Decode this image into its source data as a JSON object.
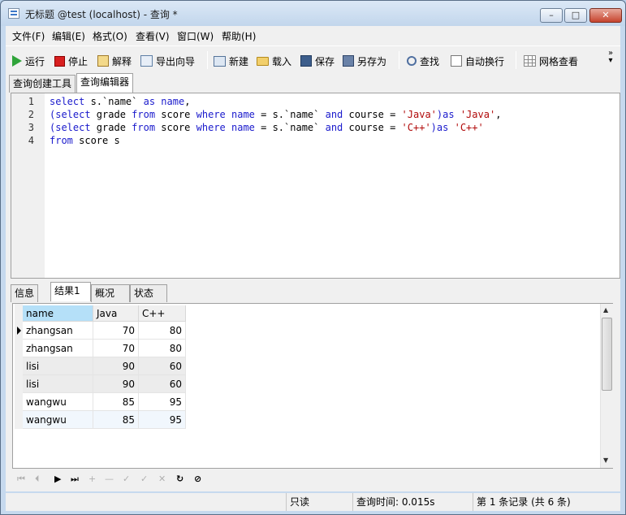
{
  "window": {
    "title": "无标题 @test (localhost) - 查询 *",
    "minimize_glyph": "–",
    "maximize_glyph": "□",
    "close_glyph": "✕"
  },
  "menu": [
    "文件(F)",
    "编辑(E)",
    "格式(O)",
    "查看(V)",
    "窗口(W)",
    "帮助(H)"
  ],
  "toolbar": {
    "run": "运行",
    "stop": "停止",
    "explain": "解释",
    "export_wizard": "导出向导",
    "new": "新建",
    "load": "载入",
    "save": "保存",
    "save_as": "另存为",
    "find": "查找",
    "word_wrap": "自动换行",
    "grid_view": "网格查看",
    "more": "» ▾"
  },
  "tabs": {
    "query_builder": "查询创建工具",
    "query_editor": "查询编辑器"
  },
  "editor": {
    "lines": [
      {
        "no": "1",
        "tokens": [
          [
            "kw",
            "select"
          ],
          [
            "plain",
            " s.`name` "
          ],
          [
            "kw",
            "as"
          ],
          [
            "plain",
            " "
          ],
          [
            "kw",
            "name"
          ],
          [
            "plain",
            ","
          ]
        ]
      },
      {
        "no": "2",
        "tokens": [
          [
            "kw",
            "(select"
          ],
          [
            "plain",
            " grade "
          ],
          [
            "kw",
            "from"
          ],
          [
            "plain",
            " score "
          ],
          [
            "kw",
            "where"
          ],
          [
            "plain",
            " "
          ],
          [
            "kw",
            "name"
          ],
          [
            "plain",
            " = s.`name` "
          ],
          [
            "kw",
            "and"
          ],
          [
            "plain",
            " course = "
          ],
          [
            "str",
            "'Java'"
          ],
          [
            "kw",
            ")as"
          ],
          [
            "plain",
            " "
          ],
          [
            "str",
            "'Java'"
          ],
          [
            "plain",
            ","
          ]
        ]
      },
      {
        "no": "3",
        "tokens": [
          [
            "kw",
            "(select"
          ],
          [
            "plain",
            " grade "
          ],
          [
            "kw",
            "from"
          ],
          [
            "plain",
            " score "
          ],
          [
            "kw",
            "where"
          ],
          [
            "plain",
            " "
          ],
          [
            "kw",
            "name"
          ],
          [
            "plain",
            " = s.`name` "
          ],
          [
            "kw",
            "and"
          ],
          [
            "plain",
            " course = "
          ],
          [
            "str",
            "'C++'"
          ],
          [
            "kw",
            ")as"
          ],
          [
            "plain",
            " "
          ],
          [
            "str",
            "'C++'"
          ]
        ]
      },
      {
        "no": "4",
        "tokens": [
          [
            "kw",
            "from"
          ],
          [
            "plain",
            " score s"
          ]
        ]
      }
    ]
  },
  "result_tabs": [
    "信息",
    "结果1",
    "概况",
    "状态"
  ],
  "grid": {
    "columns": [
      "name",
      "Java",
      "C++"
    ],
    "rows": [
      [
        "zhangsan",
        "70",
        "80"
      ],
      [
        "zhangsan",
        "70",
        "80"
      ],
      [
        "lisi",
        "90",
        "60"
      ],
      [
        "lisi",
        "90",
        "60"
      ],
      [
        "wangwu",
        "85",
        "95"
      ],
      [
        "wangwu",
        "85",
        "95"
      ]
    ]
  },
  "navigator": [
    "⏮",
    "⏴",
    "▶",
    "⏭",
    "+",
    "—",
    "✓",
    "✓",
    "✕",
    "↻",
    "⊘"
  ],
  "status": {
    "read_only": "只读",
    "query_time": "查询时间: 0.015s",
    "record_info": "第 1 条记录 (共 6 条)"
  },
  "colors": {
    "keyword": "#1a1acc",
    "string": "#b10a0a",
    "selected_header": "#b5e0f8"
  }
}
